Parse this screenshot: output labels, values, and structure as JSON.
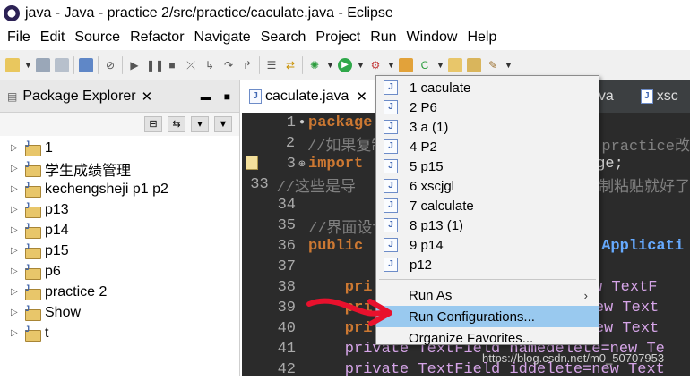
{
  "window": {
    "title": "java - Java - practice 2/src/practice/caculate.java - Eclipse"
  },
  "menubar": [
    "File",
    "Edit",
    "Source",
    "Refactor",
    "Navigate",
    "Search",
    "Project",
    "Run",
    "Window",
    "Help"
  ],
  "package_explorer": {
    "tab_label": "Package Explorer",
    "close": "✕",
    "items": [
      "1",
      "学生成绩管理",
      "kechengsheji p1 p2",
      "p13",
      "p14",
      "p15",
      "p6",
      "practice 2",
      "Show",
      "t"
    ]
  },
  "editor": {
    "active_tab": "caculate.java",
    "close": "✕",
    "other_tabs": [
      ".java",
      "xsc"
    ],
    "lines": [
      {
        "num": "1",
        "marker": "●",
        "code": "package"
      },
      {
        "num": "2",
        "marker": "",
        "code": "//如果复制"
      },
      {
        "num": "3",
        "marker": "⊕",
        "code": "import"
      },
      {
        "num": "33",
        "marker": "",
        "code": "//这些是导"
      },
      {
        "num": "34",
        "marker": "",
        "code": ""
      },
      {
        "num": "35",
        "marker": "",
        "code": "//界面设计"
      },
      {
        "num": "36",
        "marker": "",
        "code": "public"
      },
      {
        "num": "37",
        "marker": "",
        "code": ""
      },
      {
        "num": "38",
        "marker": "",
        "code": "    pri"
      },
      {
        "num": "39",
        "marker": "",
        "code": "    pri"
      },
      {
        "num": "40",
        "marker": "",
        "code": "    pri"
      },
      {
        "num": "41",
        "marker": "",
        "code": "    private TextField namedelete=new Te"
      },
      {
        "num": "42",
        "marker": "",
        "code": "    private TextField iddelete=new Text"
      }
    ],
    "right_fragments": {
      "l2": "practice改",
      "l3": "ge;",
      "l33": "复制粘贴就好了",
      "l36": "Applicati",
      "l38": "=new TextF",
      "l39": "=new Text",
      "l40": "=new Text"
    }
  },
  "run_menu": {
    "history": [
      "1 caculate",
      "2 P6",
      "3 a (1)",
      "4 P2",
      "5 p15",
      "6 xscjgl",
      "7 calculate",
      "8 p13 (1)",
      "9 p14",
      "p12"
    ],
    "run_as": "Run As",
    "run_configurations": "Run Configurations...",
    "organize_favorites": "Organize Favorites...",
    "submenu_arrow": "›"
  },
  "watermark": "https://blog.csdn.net/m0_50707953",
  "colors": {
    "selection": "#99c9ef",
    "editor_bg": "#2b2b2b",
    "keyword": "#cc7832",
    "arrow": "#e8112d"
  }
}
